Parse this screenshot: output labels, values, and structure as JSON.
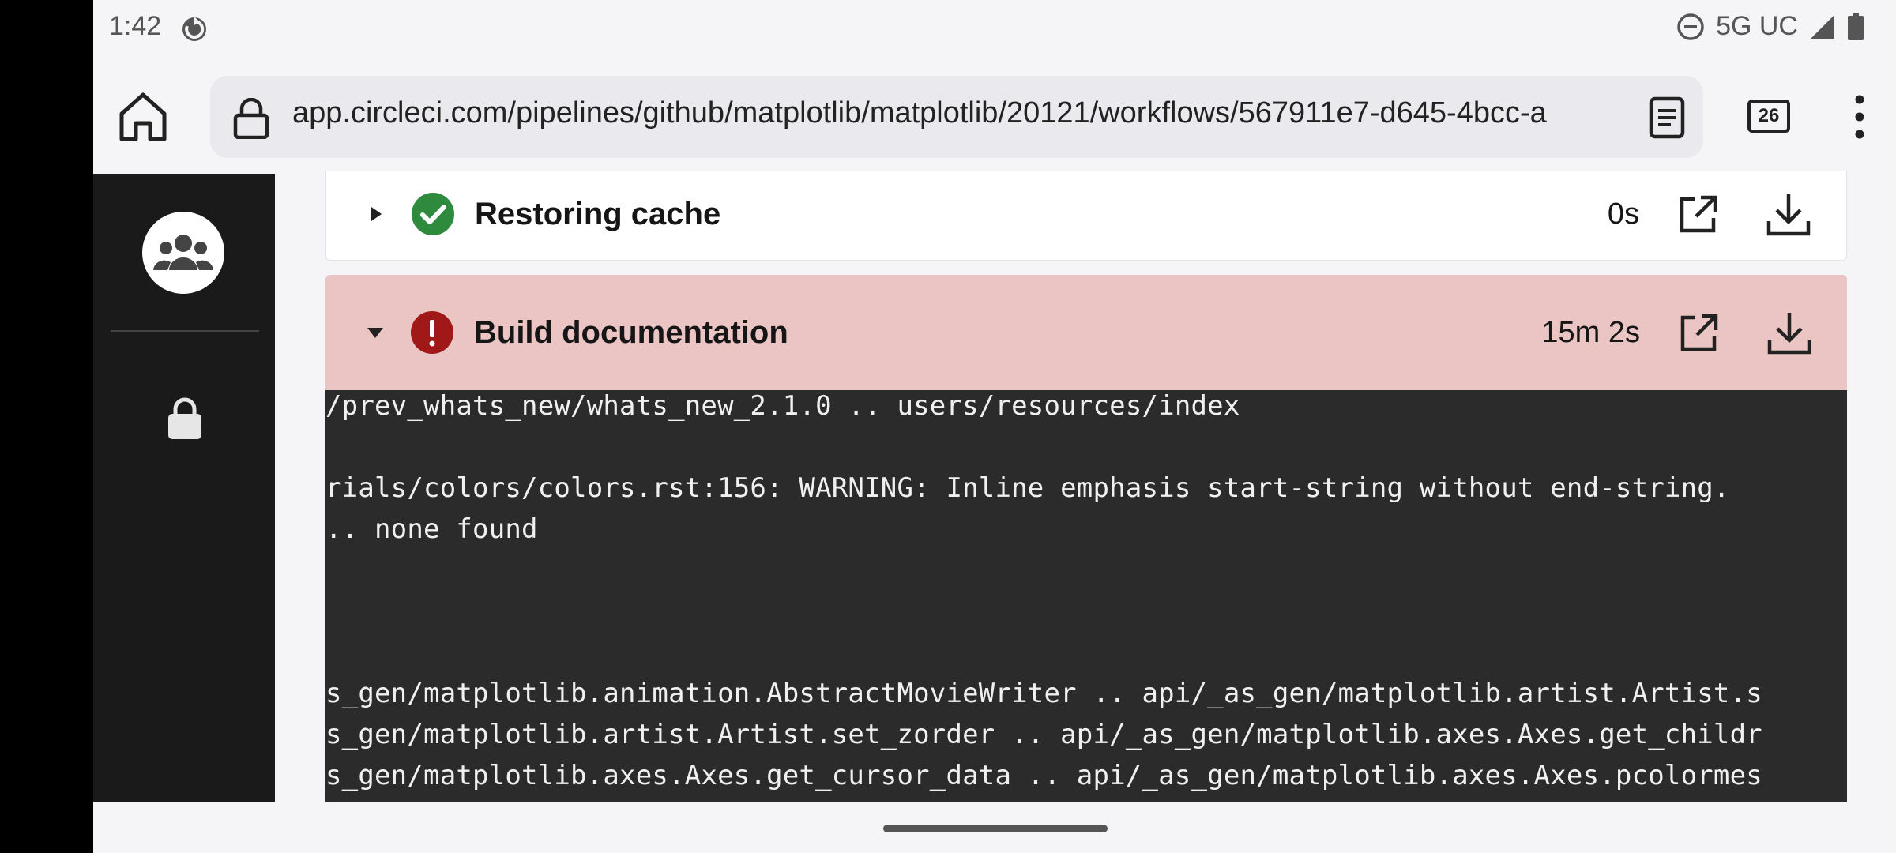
{
  "status_bar": {
    "time": "1:42",
    "network": "5G UC"
  },
  "browser": {
    "url": "app.circleci.com/pipelines/github/matplotlib/matplotlib/20121/workflows/567911e7-d645-4bcc-a",
    "tab_count": "26",
    "icons": [
      "home-icon",
      "lock-icon",
      "reader-mode-icon",
      "tabs-icon",
      "more-vert-icon"
    ]
  },
  "sidebar": {
    "icons": [
      "org-avatar-icon",
      "lock-icon"
    ]
  },
  "steps": [
    {
      "title": "Restoring cache",
      "duration": "0s",
      "status": "success",
      "expanded": false
    },
    {
      "title": "Build documentation",
      "duration": "15m 2s",
      "status": "failed",
      "expanded": true
    }
  ],
  "terminal_lines": [
    "/prev_whats_new/whats_new_2.1.0 .. users/resources/index",
    "",
    "rials/colors/colors.rst:156: WARNING: Inline emphasis start-string without end-string.",
    ".. none found",
    "",
    "",
    "",
    "s_gen/matplotlib.animation.AbstractMovieWriter .. api/_as_gen/matplotlib.artist.Artist.s",
    "s_gen/matplotlib.artist.Artist.set_zorder .. api/_as_gen/matplotlib.axes.Axes.get_childr",
    "s_gen/matplotlib.axes.Axes.get_cursor_data .. api/_as_gen/matplotlib.axes.Axes.pcolormes"
  ],
  "colors": {
    "success": "#2e8b3e",
    "failed": "#a01818",
    "failed_bg": "#ebc4c4",
    "terminal_bg": "#2b2b2b",
    "sidebar_bg": "#1a1a1a"
  }
}
